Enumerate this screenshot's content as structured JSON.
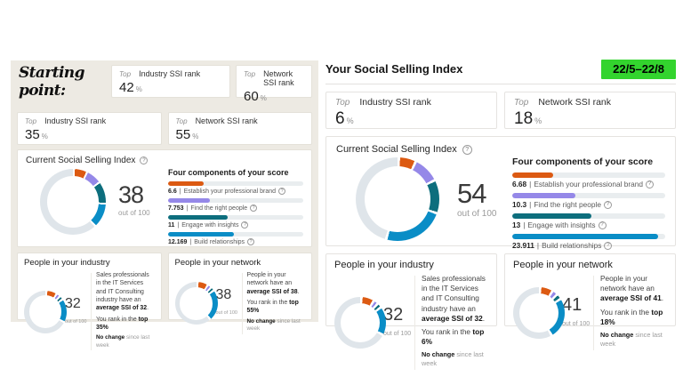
{
  "ui": {
    "top": "Top",
    "percent": "%",
    "out_of": "out of 100",
    "separator": "|"
  },
  "colors": {
    "orange": "#dc5a12",
    "purple": "#9588e8",
    "teal": "#0d6e7d",
    "blue": "#0a8dc6",
    "donut_track": "#dfe5ea",
    "badge_green": "#33d42e"
  },
  "left": {
    "heading": "Starting point:",
    "header_cards": [
      {
        "prefix": "Top",
        "title": "Industry SSI rank",
        "value": "42"
      },
      {
        "prefix": "Top",
        "title": "Network SSI rank",
        "value": "60"
      }
    ],
    "rank_cards": [
      {
        "prefix": "Top",
        "title": "Industry SSI rank",
        "value": "35"
      },
      {
        "prefix": "Top",
        "title": "Network SSI rank",
        "value": "55"
      }
    ],
    "current": {
      "title": "Current Social Selling Index",
      "score": "38",
      "components_title": "Four components of your score",
      "donut": {
        "gap": 1,
        "segments": [
          {
            "c": "orange",
            "v": 6.6
          },
          {
            "c": "purple",
            "v": 7.8
          },
          {
            "c": "teal",
            "v": 11
          },
          {
            "c": "blue",
            "v": 12.2
          }
        ]
      },
      "components": [
        {
          "value": "6.6",
          "label": "Establish your professional brand",
          "pct": 26.4,
          "color": "orange"
        },
        {
          "value": "7.753",
          "label": "Find the right people",
          "pct": 31,
          "color": "purple"
        },
        {
          "value": "11",
          "label": "Engage with insights",
          "pct": 44,
          "color": "teal"
        },
        {
          "value": "12.169",
          "label": "Build relationships",
          "pct": 48.7,
          "color": "blue"
        }
      ]
    },
    "industry": {
      "title": "People in your industry",
      "score": "32",
      "donut": {
        "gap": 1.6,
        "segments": [
          {
            "c": "orange",
            "v": 8
          },
          {
            "c": "purple",
            "v": 3
          },
          {
            "c": "teal",
            "v": 3
          },
          {
            "c": "blue",
            "v": 18
          }
        ]
      },
      "desc_a": "Sales professionals in the IT Services and IT Consulting industry have an ",
      "desc_b": "average SSI of 32",
      "desc_c": ".",
      "rank_a": "You rank in the ",
      "rank_b": "top 35%",
      "change_b": "No change",
      "change_a": " since last week"
    },
    "network": {
      "title": "People in your network",
      "score": "38",
      "donut": {
        "gap": 1.6,
        "segments": [
          {
            "c": "orange",
            "v": 8
          },
          {
            "c": "purple",
            "v": 3
          },
          {
            "c": "teal",
            "v": 3
          },
          {
            "c": "blue",
            "v": 24
          }
        ]
      },
      "desc_a": "People in your network have an ",
      "desc_b": "average SSI of 38",
      "desc_c": ".",
      "rank_a": "You rank in the ",
      "rank_b": "top 55%",
      "change_b": "No change",
      "change_a": " since last week"
    }
  },
  "right": {
    "header": "Your Social Selling Index",
    "badge": "22/5–22/8",
    "header_cards": [
      {
        "prefix": "Top",
        "title": "Industry SSI rank",
        "value": "6"
      },
      {
        "prefix": "Top",
        "title": "Network SSI rank",
        "value": "18"
      }
    ],
    "current": {
      "title": "Current Social Selling Index",
      "score": "54",
      "components_title": "Four components of your score",
      "donut": {
        "gap": 1,
        "segments": [
          {
            "c": "orange",
            "v": 6.7
          },
          {
            "c": "purple",
            "v": 10.3
          },
          {
            "c": "teal",
            "v": 13
          },
          {
            "c": "blue",
            "v": 23.9
          }
        ]
      },
      "components": [
        {
          "value": "6.68",
          "label": "Establish your professional brand",
          "pct": 26.7,
          "color": "orange"
        },
        {
          "value": "10.3",
          "label": "Find the right people",
          "pct": 41.2,
          "color": "purple"
        },
        {
          "value": "13",
          "label": "Engage with insights",
          "pct": 52,
          "color": "teal"
        },
        {
          "value": "23.911",
          "label": "Build relationships",
          "pct": 95.6,
          "color": "blue"
        }
      ]
    },
    "industry": {
      "title": "People in your industry",
      "score": "32",
      "donut": {
        "gap": 1.6,
        "segments": [
          {
            "c": "orange",
            "v": 8
          },
          {
            "c": "purple",
            "v": 3
          },
          {
            "c": "teal",
            "v": 3
          },
          {
            "c": "blue",
            "v": 18
          }
        ]
      },
      "desc_a": "Sales professionals in the IT Services and IT Consulting industry have an ",
      "desc_b": "average SSI of 32",
      "desc_c": ".",
      "rank_a": "You rank in the ",
      "rank_b": "top 6%",
      "change_b": "No change",
      "change_a": " since last week"
    },
    "network": {
      "title": "People in your network",
      "score": "41",
      "donut": {
        "gap": 1.6,
        "segments": [
          {
            "c": "orange",
            "v": 8
          },
          {
            "c": "purple",
            "v": 3.5
          },
          {
            "c": "teal",
            "v": 3.5
          },
          {
            "c": "blue",
            "v": 26
          }
        ]
      },
      "desc_a": "People in your network have an ",
      "desc_b": "average SSI of 41",
      "desc_c": ".",
      "rank_a": "You rank in the ",
      "rank_b": "top 18%",
      "change_b": "No change",
      "change_a": " since last week"
    }
  }
}
